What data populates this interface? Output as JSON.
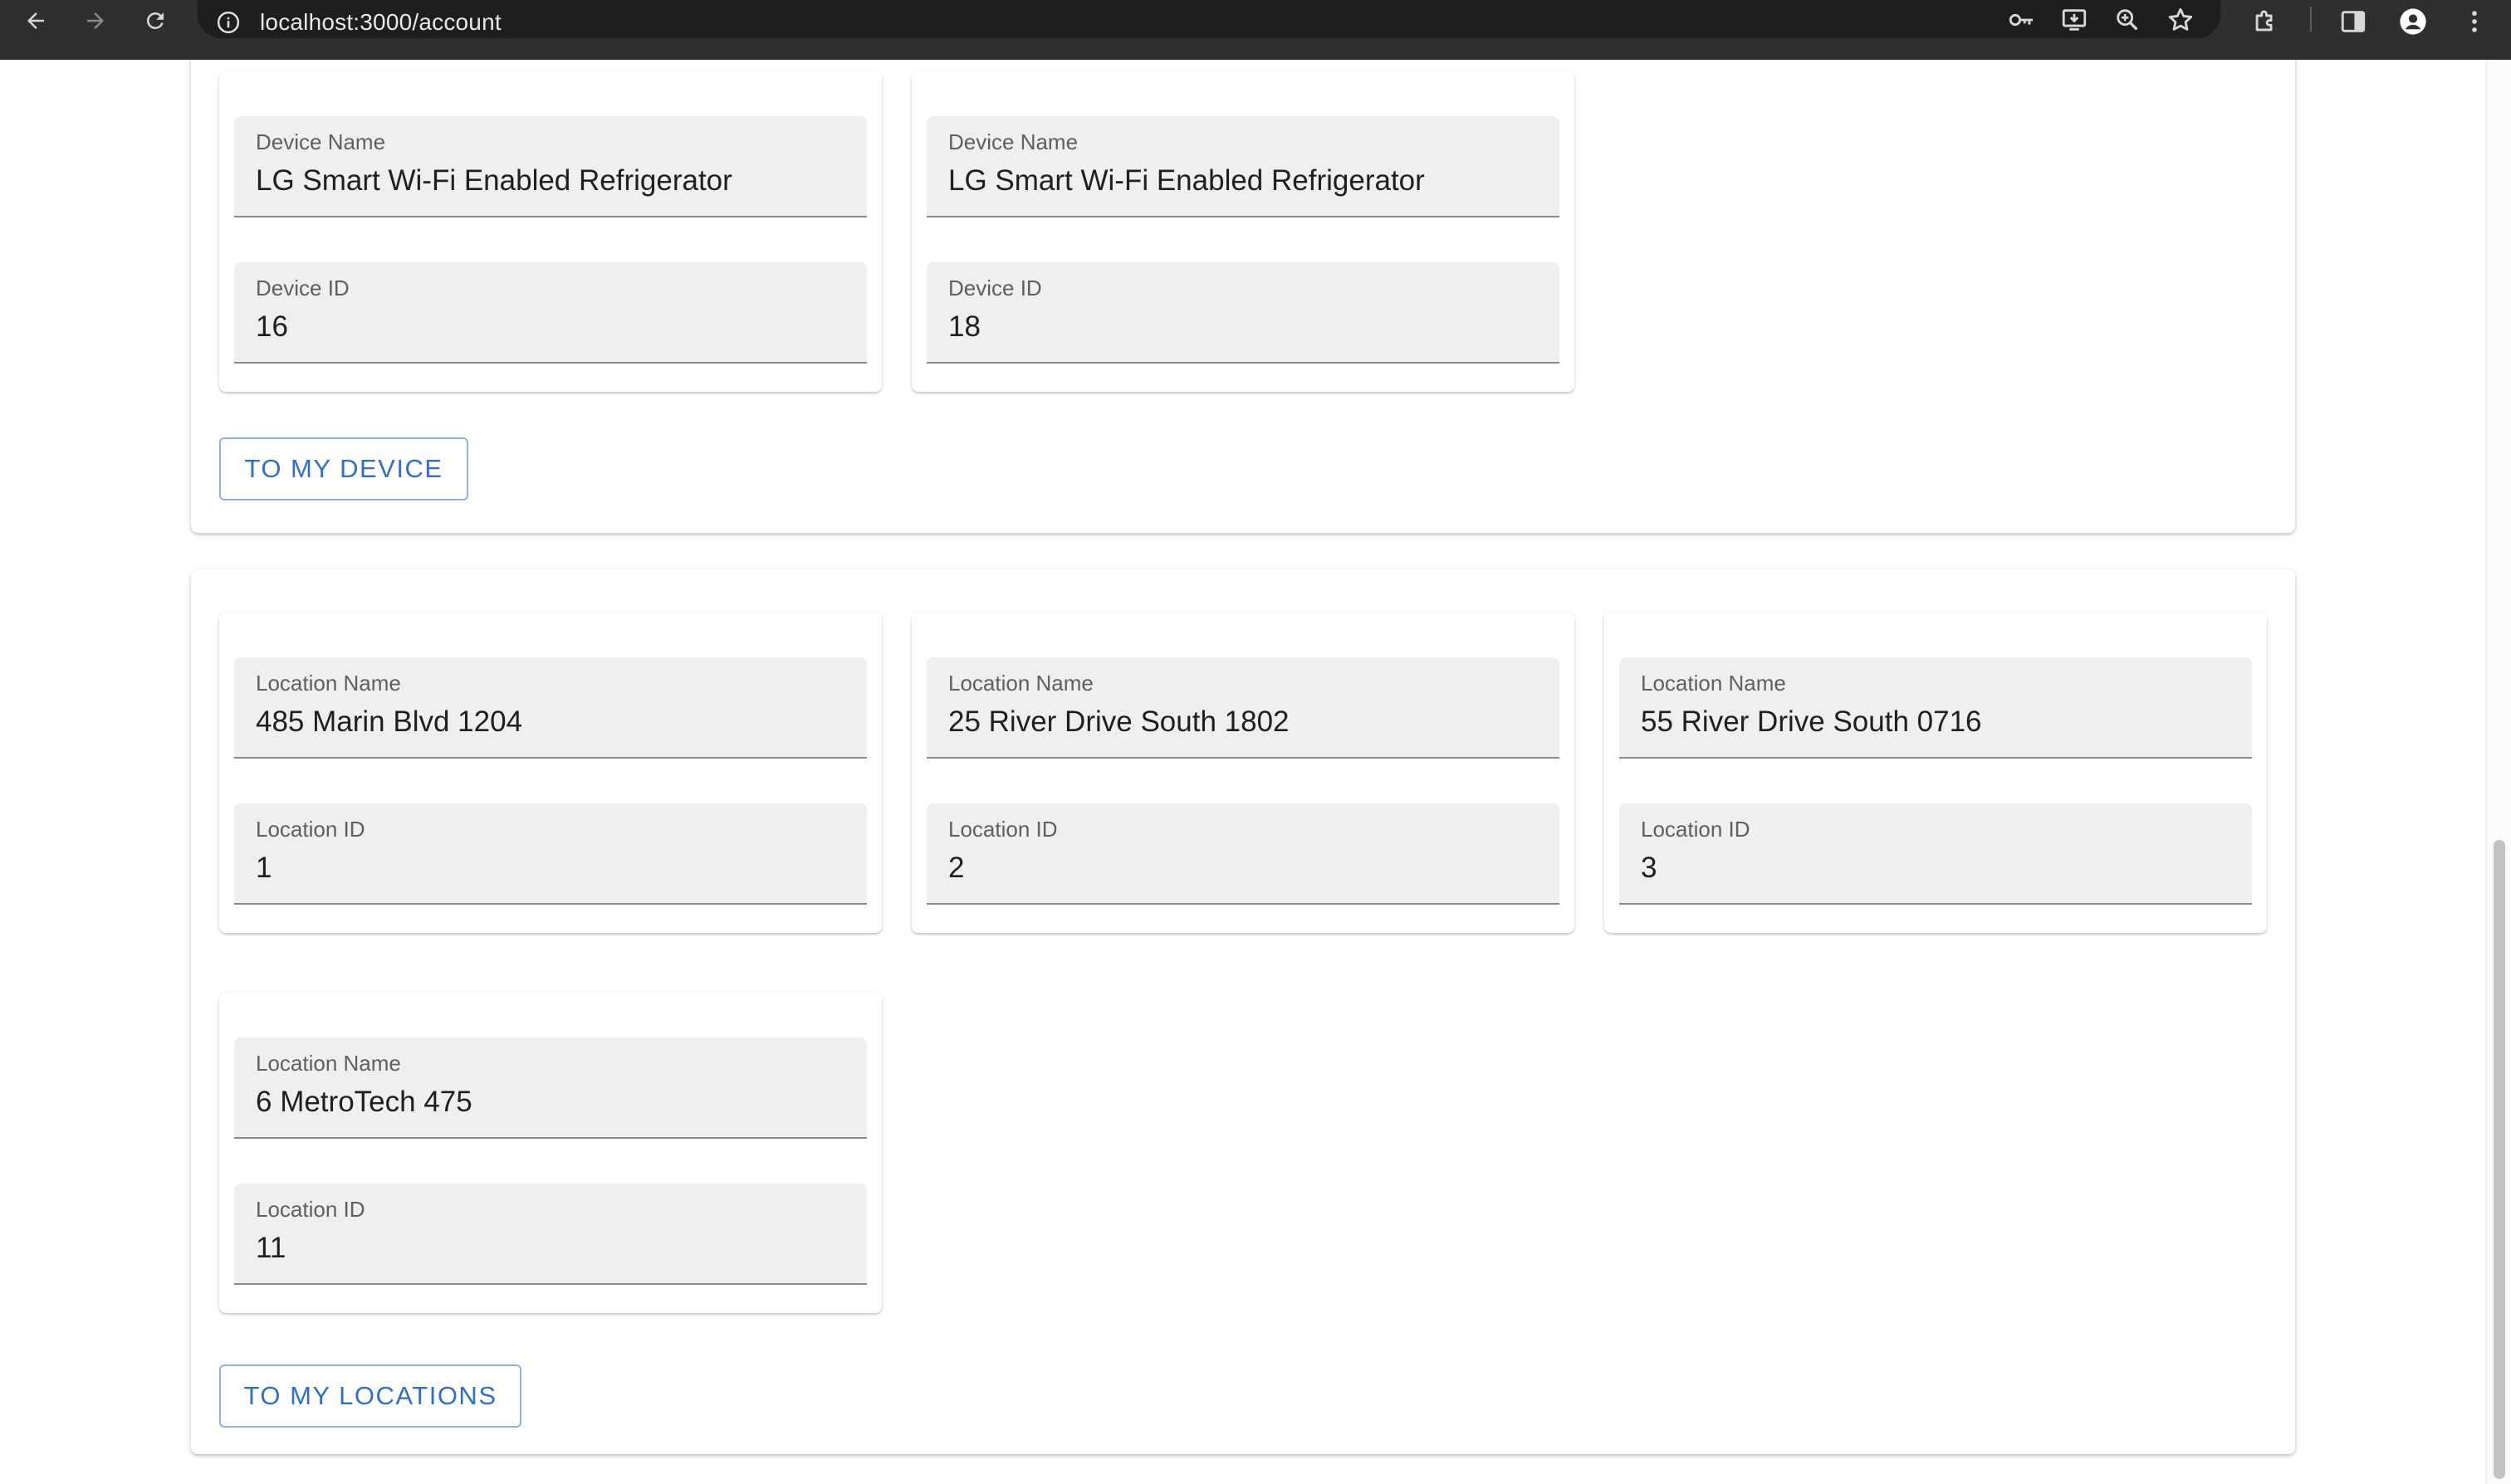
{
  "browser": {
    "url": "localhost:3000/account",
    "icons": {
      "back": "arrow-left-icon",
      "forward": "arrow-right-icon",
      "reload": "reload-icon",
      "site_info": "info-icon",
      "password": "key-icon",
      "install": "install-app-icon",
      "zoom": "zoom-icon",
      "bookmark": "star-icon",
      "extensions": "puzzle-icon",
      "side_panel": "side-panel-icon",
      "profile": "profile-icon",
      "menu": "kebab-menu-icon"
    }
  },
  "devices_section": {
    "cards": [
      {
        "name_label": "Device Name",
        "name_value": "LG Smart Wi-Fi Enabled Refrigerator",
        "id_label": "Device ID",
        "id_value": "16"
      },
      {
        "name_label": "Device Name",
        "name_value": "LG Smart Wi-Fi Enabled Refrigerator",
        "id_label": "Device ID",
        "id_value": "18"
      }
    ],
    "button_label": "TO MY DEVICE"
  },
  "locations_section": {
    "cards": [
      {
        "name_label": "Location Name",
        "name_value": "485 Marin Blvd 1204",
        "id_label": "Location ID",
        "id_value": "1"
      },
      {
        "name_label": "Location Name",
        "name_value": "25 River Drive South 1802",
        "id_label": "Location ID",
        "id_value": "2"
      },
      {
        "name_label": "Location Name",
        "name_value": "55 River Drive South 0716",
        "id_label": "Location ID",
        "id_value": "3"
      },
      {
        "name_label": "Location Name",
        "name_value": "6 MetroTech 475",
        "id_label": "Location ID",
        "id_value": "11"
      }
    ],
    "button_label": "TO MY LOCATIONS"
  },
  "colors": {
    "toolbar": "#2f2f2f",
    "field_bg": "#efefef",
    "button_text": "#2f6fc8",
    "button_border": "#8fb0e0"
  }
}
